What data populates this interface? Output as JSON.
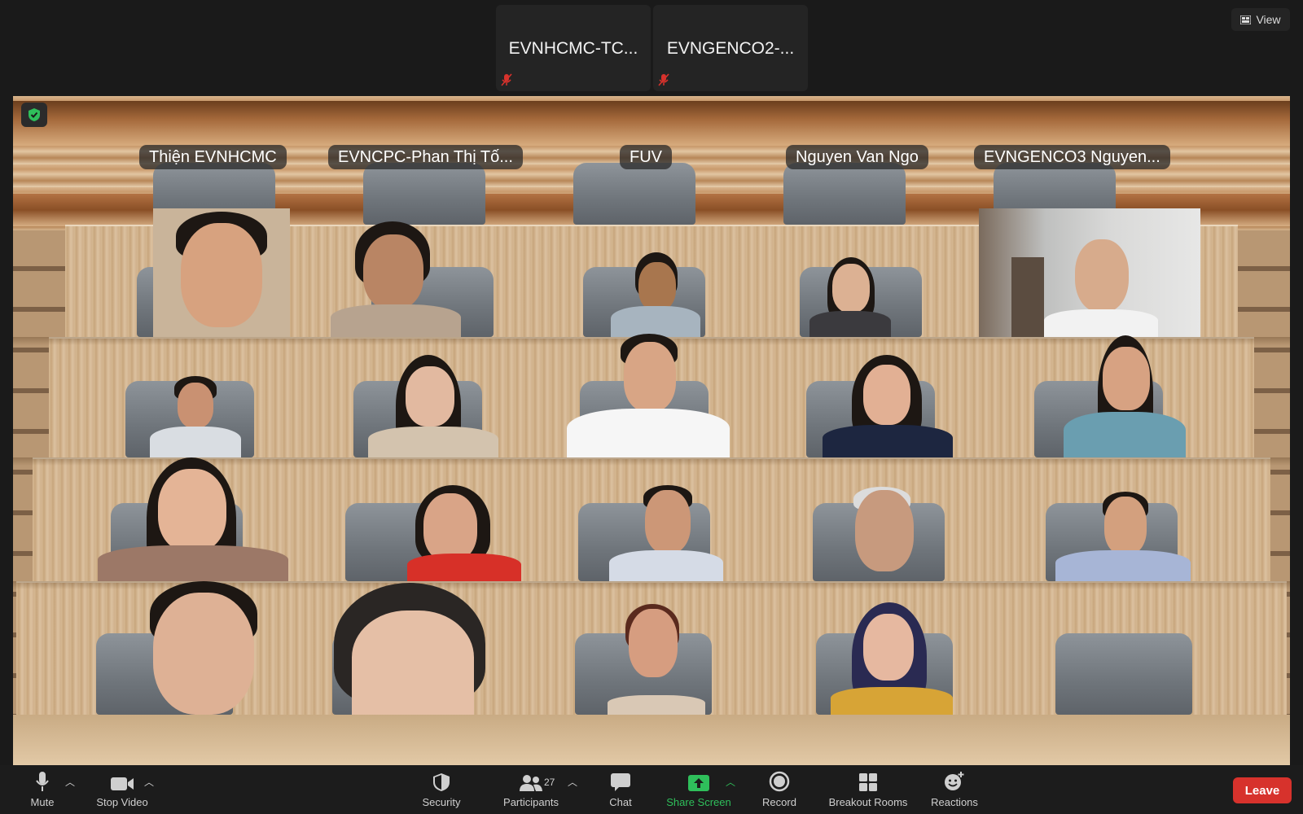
{
  "top_strip": {
    "thumbnails": [
      {
        "name": "EVNHCMC-TC...",
        "mic": "mic-off-icon"
      },
      {
        "name": "EVNGENCO2-...",
        "mic": "mic-off-icon"
      }
    ],
    "view_label": "View"
  },
  "scene": {
    "name_tags": [
      "Thiện EVNHCMC",
      "EVNCPC-Phan Thị Tố...",
      "FUV",
      "Nguyen Van Ngo",
      "EVNGENCO3 Nguyen..."
    ]
  },
  "toolbar": {
    "mute_label": "Mute",
    "stop_video_label": "Stop Video",
    "security_label": "Security",
    "participants_label": "Participants",
    "participants_count": "27",
    "chat_label": "Chat",
    "share_screen_label": "Share Screen",
    "record_label": "Record",
    "breakout_rooms_label": "Breakout Rooms",
    "reactions_label": "Reactions",
    "leave_label": "Leave"
  },
  "colors": {
    "leave": "#d7322c",
    "share": "#2fbf5b",
    "background": "#1a1a1a"
  }
}
